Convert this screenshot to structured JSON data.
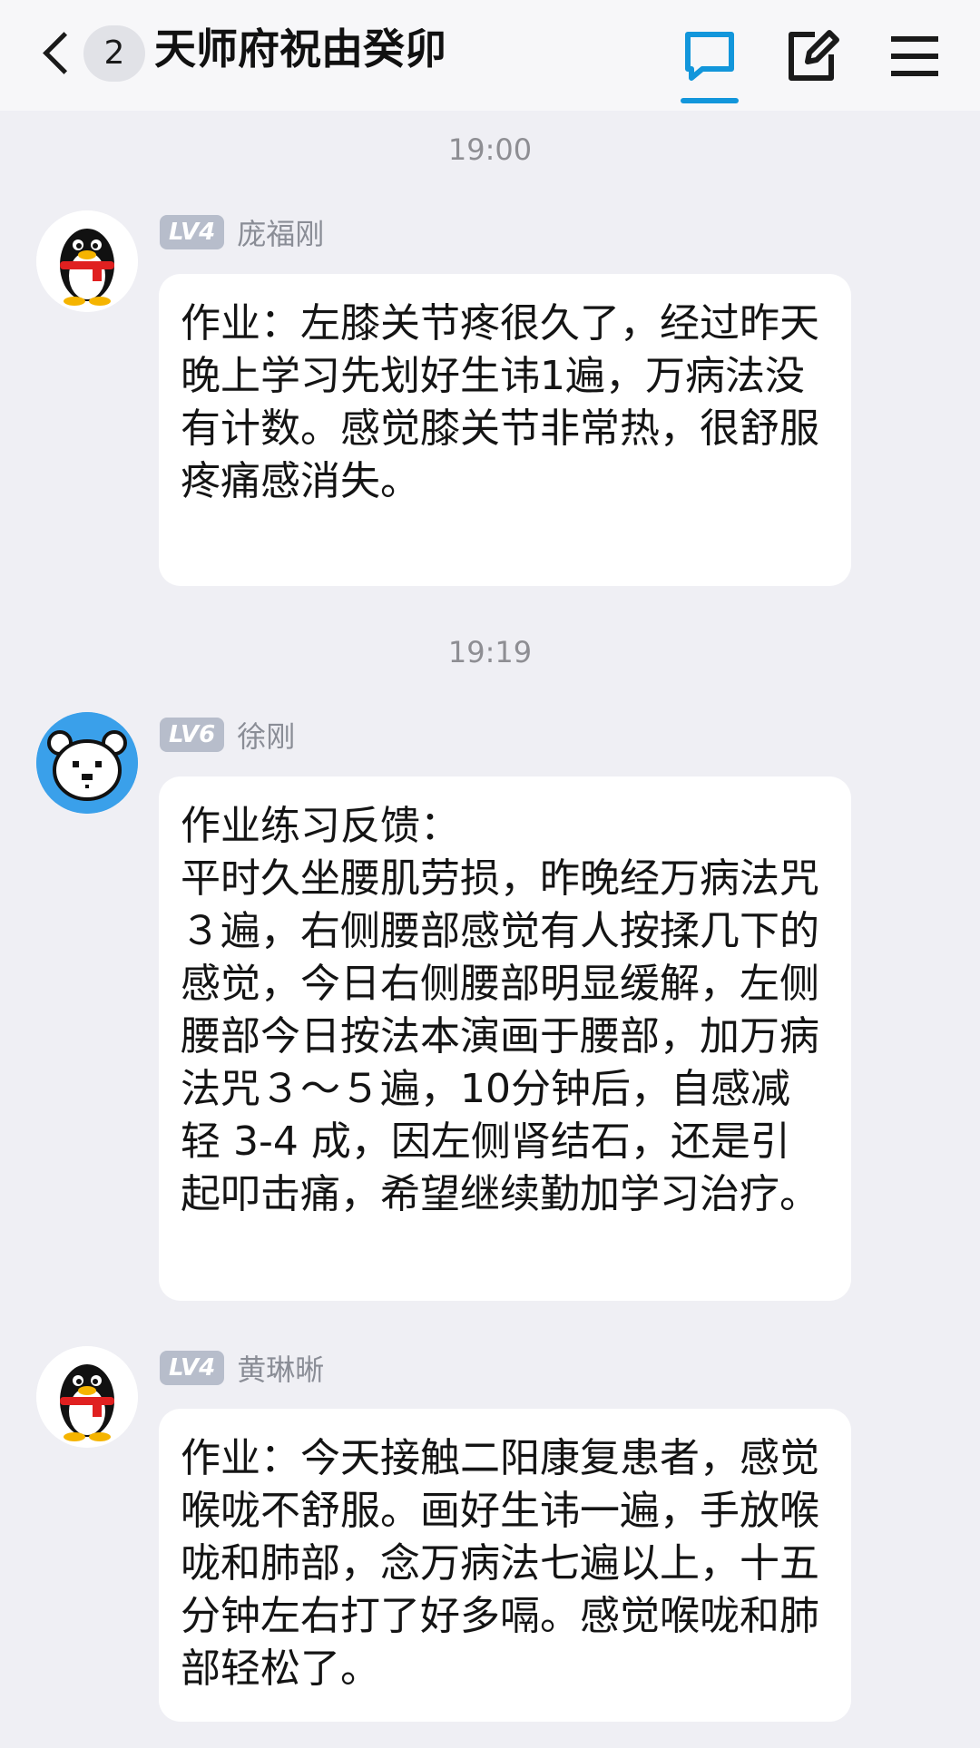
{
  "header": {
    "back_count": "2",
    "title": "天师府祝由癸卯",
    "icons": [
      "chat-icon",
      "edit-icon",
      "menu-icon"
    ],
    "accent": "#1296db"
  },
  "messages": [
    {
      "time": "19:00",
      "level": "LV4",
      "sender": "庞福刚",
      "avatar": "penguin-avatar",
      "text": "作业：左膝关节疼很久了，经过昨天晚上学习先划好生讳1遍，万病法没有计数。感觉膝关节非常热，很舒服疼痛感消失。"
    },
    {
      "time": "19:19",
      "level": "LV6",
      "sender": "徐刚",
      "avatar": "polar-bear-avatar",
      "text": "作业练习反馈：\n平时久坐腰肌劳损，昨晚经万病法咒３遍，右侧腰部感觉有人按揉几下的感觉，今日右侧腰部明显缓解，左侧腰部今日按法本演画于腰部，加万病法咒３～５遍，10分钟后，自感减轻 3-4 成，因左侧肾结石，还是引起叩击痛，希望继续勤加学习治疗。"
    },
    {
      "level": "LV4",
      "sender": "黄琳晰",
      "avatar": "penguin-avatar",
      "text": "作业：今天接触二阳康复患者，感觉喉咙不舒服。画好生讳一遍，手放喉咙和肺部，念万病法七遍以上，十五分钟左右打了好多嗝。感觉喉咙和肺部轻松了。"
    }
  ]
}
